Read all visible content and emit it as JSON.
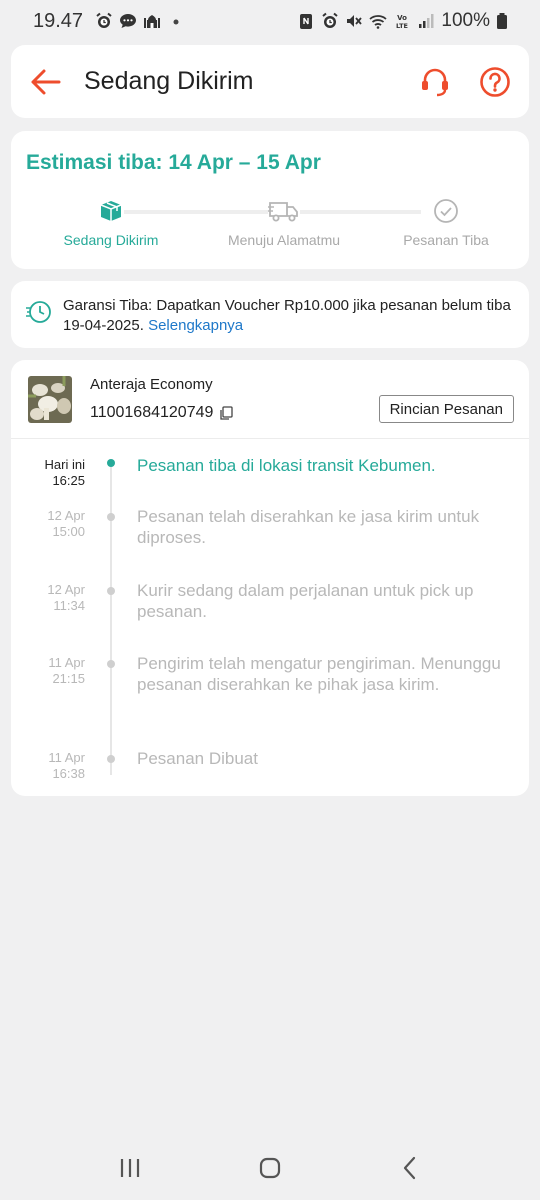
{
  "status_bar": {
    "time": "19.47",
    "battery": "100%",
    "icons_left": [
      "alarm-icon",
      "chat-bubble-icon",
      "mosque-icon",
      "dot-icon"
    ],
    "icons_right": [
      "nfc-icon",
      "alarm-icon",
      "mute-icon",
      "wifi-icon",
      "volte-icon",
      "signal-icon",
      "battery-icon"
    ]
  },
  "header": {
    "title": "Sedang Dikirim",
    "accent_color": "#ee4d2d"
  },
  "estimate": {
    "title": "Estimasi tiba: 14 Apr – 15 Apr",
    "steps": [
      {
        "label": "Sedang Dikirim",
        "state": "active",
        "icon": "package-icon"
      },
      {
        "label": "Menuju Alamatmu",
        "state": "inactive",
        "icon": "truck-icon"
      },
      {
        "label": "Pesanan Tiba",
        "state": "inactive",
        "icon": "check-circle-icon"
      }
    ],
    "accent_color": "#26aa99"
  },
  "guarantee": {
    "text": "Garansi Tiba: Dapatkan Voucher Rp10.000 jika pesanan belum tiba 19-04-2025.",
    "link": "Selengkapnya"
  },
  "courier": {
    "name": "Anteraja Economy",
    "tracking_number": "11001684120749",
    "detail_button": "Rincian Pesanan"
  },
  "timeline": [
    {
      "date": "Hari ini",
      "time": "16:25",
      "text": "Pesanan tiba di lokasi transit  Kebumen.",
      "current": true
    },
    {
      "date": "12 Apr",
      "time": "15:00",
      "text": "Pesanan telah diserahkan ke jasa kirim untuk diproses.",
      "current": false
    },
    {
      "date": "12 Apr",
      "time": "11:34",
      "text": "Kurir sedang dalam perjalanan untuk pick up pesanan.",
      "current": false
    },
    {
      "date": "11 Apr",
      "time": "21:15",
      "text": "Pengirim telah mengatur pengiriman. Menunggu pesanan diserahkan ke pihak jasa kirim.",
      "current": false
    },
    {
      "date": "11 Apr",
      "time": "16:38",
      "text": "Pesanan Dibuat",
      "current": false
    }
  ],
  "navbar": [
    "recents-icon",
    "home-icon",
    "back-icon"
  ]
}
